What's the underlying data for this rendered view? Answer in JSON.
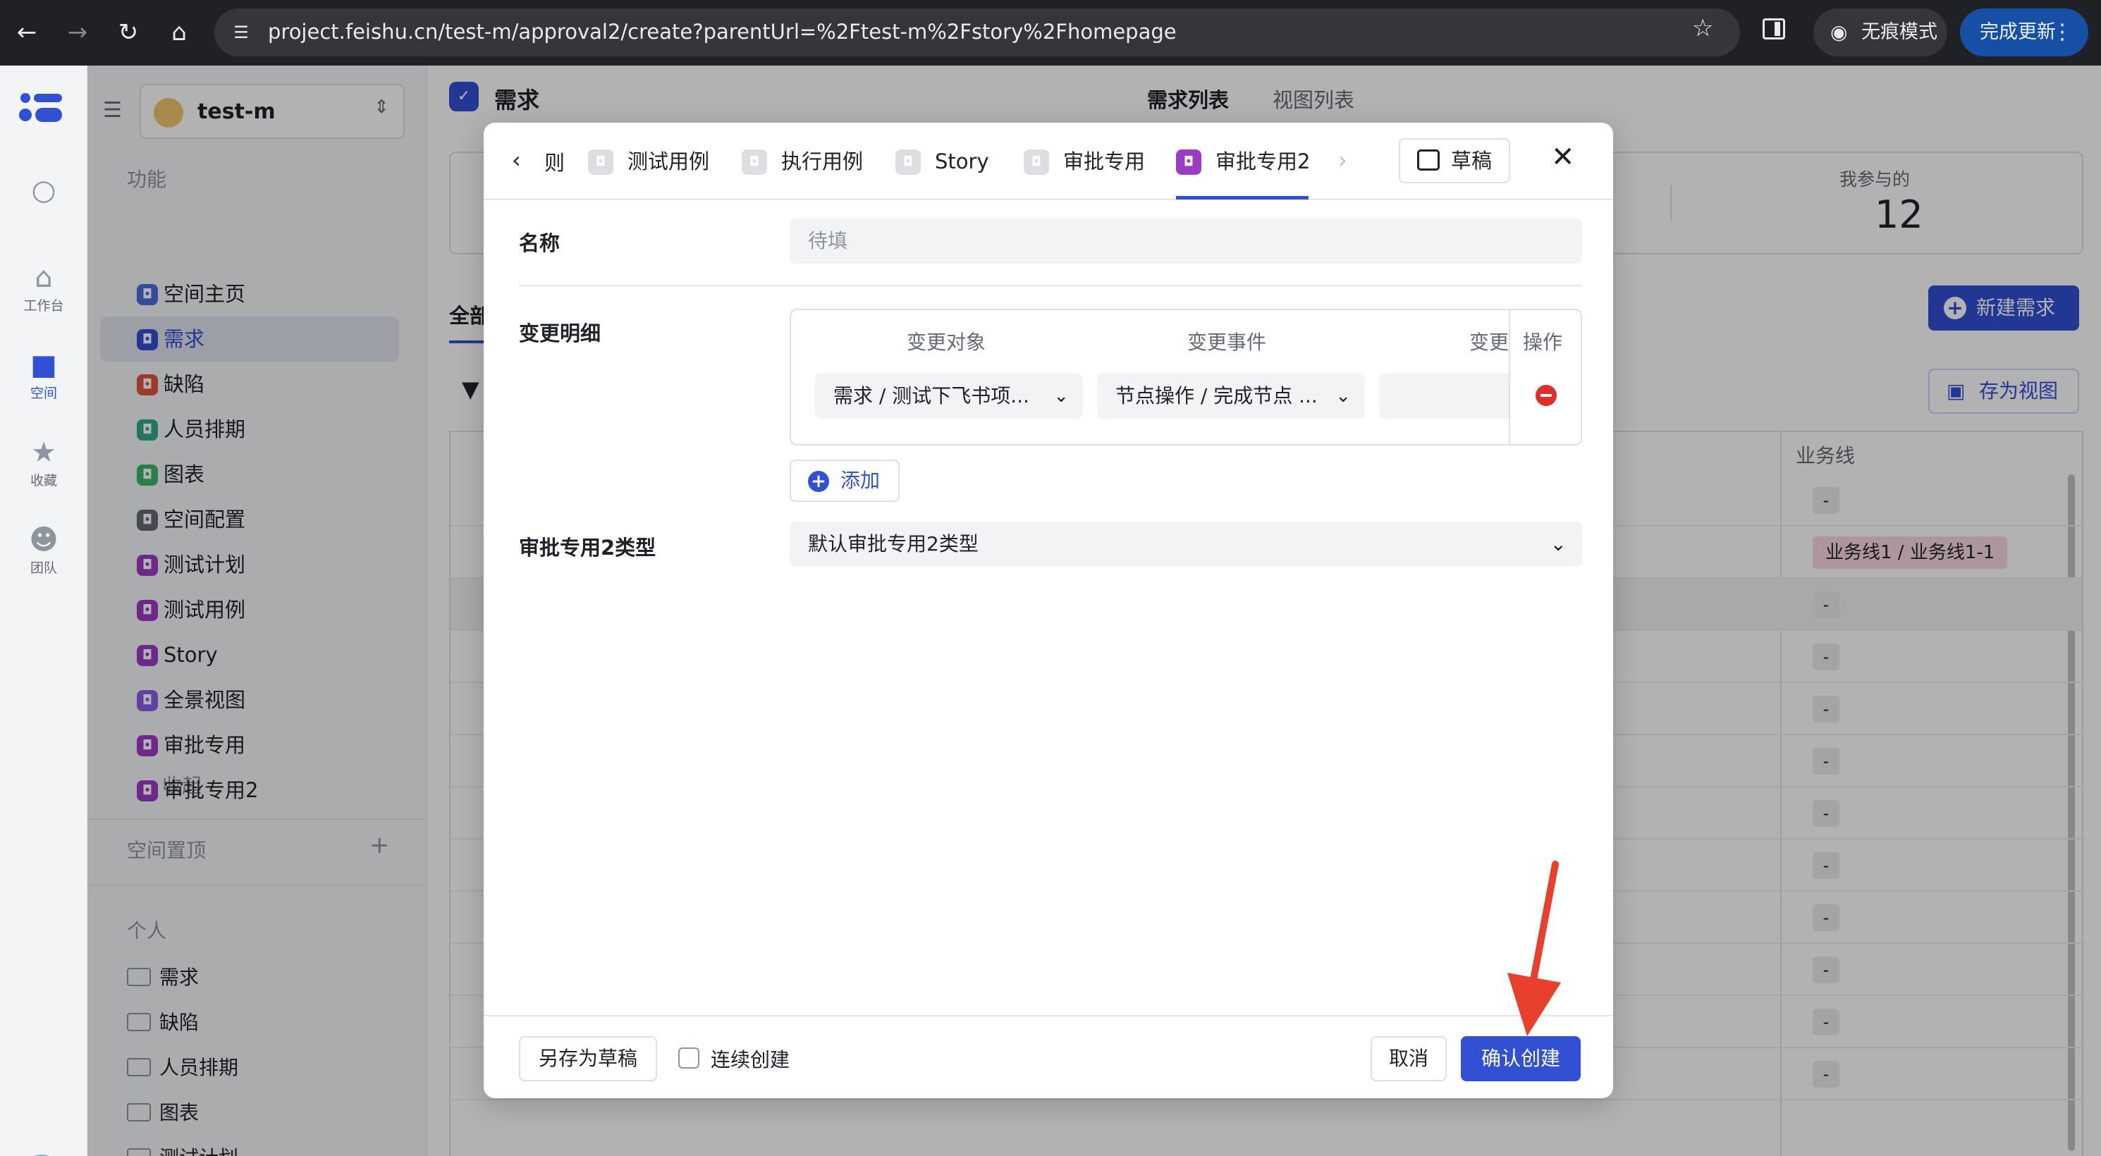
{
  "browser": {
    "url": "project.feishu.cn/test-m/approval2/create?parentUrl=%2Ftest-m%2Fstory%2Fhomepage",
    "incognito_label": "无痕模式",
    "update_label": "完成更新"
  },
  "rail": {
    "items": [
      {
        "label": "工作台",
        "icon": "home-icon"
      },
      {
        "label": "空间",
        "icon": "space-icon"
      },
      {
        "label": "收藏",
        "icon": "star-icon"
      },
      {
        "label": "团队",
        "icon": "team-icon"
      }
    ]
  },
  "sidebar": {
    "space_name": "test-m",
    "section_features": "功能",
    "items": [
      {
        "label": "空间主页",
        "color": "#4a6ee0"
      },
      {
        "label": "需求",
        "color": "#3250d4"
      },
      {
        "label": "缺陷",
        "color": "#e0533e"
      },
      {
        "label": "人员排期",
        "color": "#32a88a"
      },
      {
        "label": "图表",
        "color": "#3cb66a"
      },
      {
        "label": "空间配置",
        "color": "#646a73"
      },
      {
        "label": "测试计划",
        "color": "#9b3cc6"
      },
      {
        "label": "测试用例",
        "color": "#9b3cc6"
      },
      {
        "label": "Story",
        "color": "#9b3cc6"
      },
      {
        "label": "全景视图",
        "color": "#8d5ce8"
      },
      {
        "label": "审批专用",
        "color": "#9b3cc6"
      },
      {
        "label": "审批专用2",
        "color": "#9b3cc6"
      }
    ],
    "collapse_label": "收起",
    "section_pinned": "空间置顶",
    "section_personal": "个人",
    "personal_folders": [
      "需求",
      "缺陷",
      "人员排期",
      "图表",
      "测试计划"
    ]
  },
  "main": {
    "title": "需求",
    "tabs": [
      "需求列表",
      "视图列表"
    ],
    "stat_label": "我参与的",
    "stat_value": "12",
    "all_tab": "全部",
    "new_button": "新建需求",
    "save_view_button": "存为视图",
    "column_header": "业务线",
    "rows": [
      "-",
      "业务线1 / 业务线1-1",
      "-",
      "-",
      "-",
      "-",
      "-",
      "-",
      "-",
      "-",
      "-",
      "-"
    ]
  },
  "modal": {
    "tab_cut_label": "则",
    "tabs": [
      {
        "label": "测试用例",
        "active": false
      },
      {
        "label": "执行用例",
        "active": false
      },
      {
        "label": "Story",
        "active": false
      },
      {
        "label": "审批专用",
        "active": false
      },
      {
        "label": "审批专用2",
        "active": true
      }
    ],
    "draft_button": "草稿",
    "name_label": "名称",
    "name_placeholder": "待填",
    "change_label": "变更明细",
    "change_table": {
      "headers": [
        "变更对象",
        "变更事件",
        "变更"
      ],
      "op_header": "操作",
      "row": [
        "需求 / 测试下飞书项...",
        "节点操作 / 完成节点 ..."
      ]
    },
    "add_button": "添加",
    "type_label": "审批专用2类型",
    "type_value": "默认审批专用2类型",
    "footer": {
      "save_draft": "另存为草稿",
      "continuous_create": "连续创建",
      "cancel": "取消",
      "confirm": "确认创建"
    }
  },
  "annotation": {
    "arrow_color": "#e8402c"
  }
}
